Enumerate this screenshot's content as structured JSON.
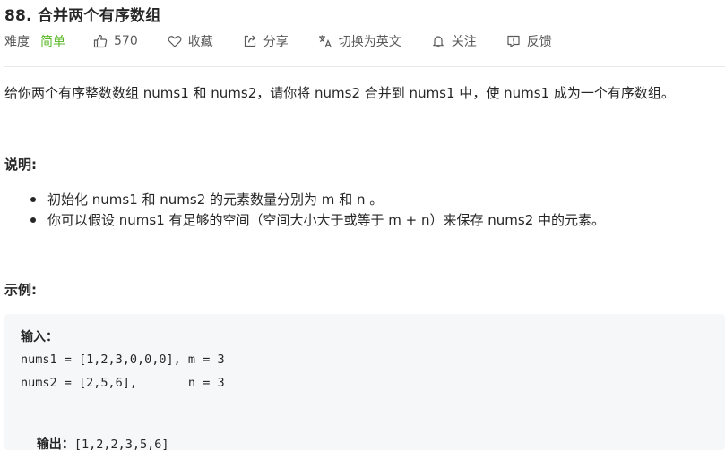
{
  "problem": {
    "title": "88. 合并两个有序数组"
  },
  "meta": {
    "difficulty_label": "难度",
    "difficulty_value": "简单",
    "likes": "570",
    "favorite_label": "收藏",
    "share_label": "分享",
    "translate_label": "切换为英文",
    "follow_label": "关注",
    "feedback_label": "反馈",
    "colors": {
      "easy": "#5ab726",
      "text": "#595959"
    }
  },
  "description": {
    "intro": "给你两个有序整数数组 nums1 和 nums2，请你将 nums2 合并到 nums1 中，使 nums1 成为一个有序数组。",
    "explain_heading": "说明:",
    "notes": [
      "初始化 nums1 和 nums2 的元素数量分别为 m 和 n 。",
      "你可以假设 nums1 有足够的空间（空间大小大于或等于 m + n）来保存 nums2 中的元素。"
    ],
    "example_heading": "示例:"
  },
  "example": {
    "input_label": "输入：",
    "input_line1": "nums1 = [1,2,3,0,0,0], m = 3",
    "input_line2": "nums2 = [2,5,6],       n = 3",
    "output_label": "输出：",
    "output_value": "[1,2,2,3,5,6]"
  }
}
